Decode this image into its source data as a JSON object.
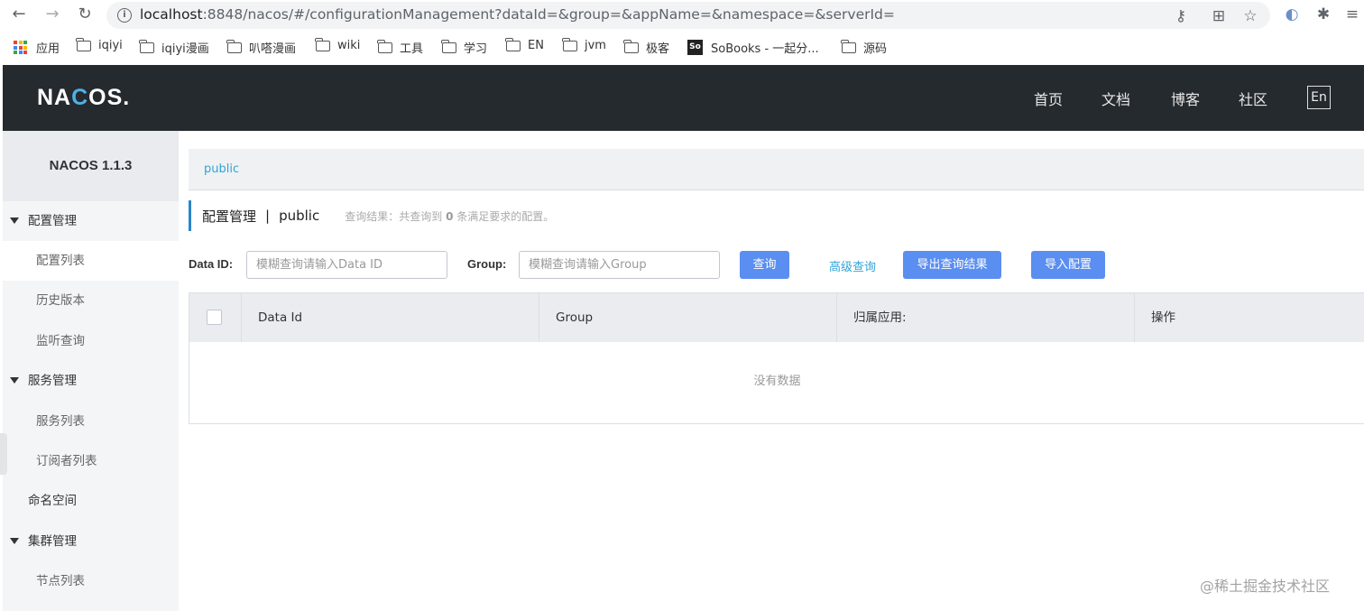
{
  "browser": {
    "url_host": "localhost",
    "url_rest": ":8848/nacos/#/configurationManagement?dataId=&group=&appName=&namespace=&serverId=",
    "bookmarks": [
      "应用",
      "iqiyi",
      "iqiyi漫画",
      "叭嗒漫画",
      "wiki",
      "工具",
      "学习",
      "EN",
      "jvm",
      "极客",
      "SoBooks - 一起分...",
      "源码"
    ]
  },
  "header": {
    "logo_a": "NA",
    "logo_c": "C",
    "logo_b": "OS.",
    "nav": [
      "首页",
      "文档",
      "博客",
      "社区"
    ],
    "lang": "En"
  },
  "sidebar": {
    "version": "NACOS 1.1.3",
    "groups": {
      "config": "配置管理",
      "service": "服务管理",
      "namespace": "命名空间",
      "cluster": "集群管理"
    },
    "items": {
      "config_list": "配置列表",
      "history": "历史版本",
      "listener": "监听查询",
      "service_list": "服务列表",
      "subscriber": "订阅者列表",
      "nodes": "节点列表"
    }
  },
  "main": {
    "namespace_tab": "public",
    "title": "配置管理",
    "title_ns": "public",
    "result_prefix": "查询结果：共查询到",
    "result_count": "0",
    "result_suffix": "条满足要求的配置。",
    "data_id_label": "Data ID:",
    "data_id_placeholder": "模糊查询请输入Data ID",
    "group_label": "Group:",
    "group_placeholder": "模糊查询请输入Group",
    "query_btn": "查询",
    "advanced_query": "高级查询",
    "export_btn": "导出查询结果",
    "import_btn": "导入配置",
    "columns": [
      "Data Id",
      "Group",
      "归属应用:",
      "操作"
    ],
    "empty_text": "没有数据"
  },
  "watermark": "@稀土掘金技术社区"
}
